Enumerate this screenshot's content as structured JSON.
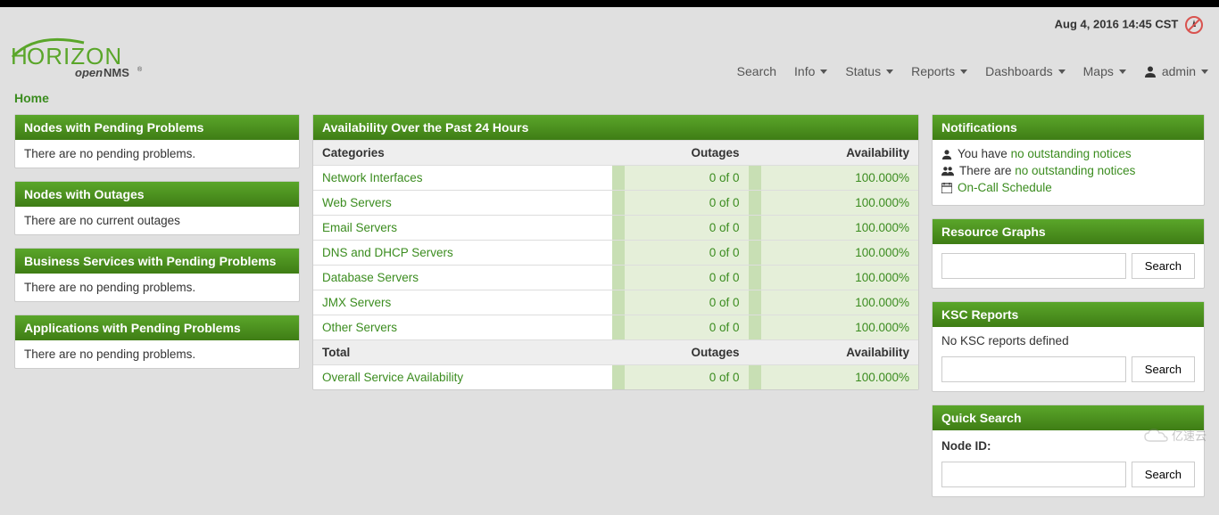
{
  "header": {
    "datetime": "Aug 4, 2016 14:45 CST",
    "logo_main": "HORIZON",
    "logo_sub": "openNMS"
  },
  "nav": {
    "search": "Search",
    "info": "Info",
    "status": "Status",
    "reports": "Reports",
    "dashboards": "Dashboards",
    "maps": "Maps",
    "admin": "admin"
  },
  "breadcrumb": {
    "home": "Home"
  },
  "left_panels": {
    "pending_nodes": {
      "title": "Nodes with Pending Problems",
      "body": "There are no pending problems."
    },
    "outages": {
      "title": "Nodes with Outages",
      "body": "There are no current outages"
    },
    "biz": {
      "title": "Business Services with Pending Problems",
      "body": "There are no pending problems."
    },
    "apps": {
      "title": "Applications with Pending Problems",
      "body": "There are no pending problems."
    }
  },
  "availability": {
    "title": "Availability Over the Past 24 Hours",
    "col_categories": "Categories",
    "col_outages": "Outages",
    "col_availability": "Availability",
    "rows": [
      {
        "name": "Network Interfaces",
        "outages": "0 of 0",
        "avail": "100.000%"
      },
      {
        "name": "Web Servers",
        "outages": "0 of 0",
        "avail": "100.000%"
      },
      {
        "name": "Email Servers",
        "outages": "0 of 0",
        "avail": "100.000%"
      },
      {
        "name": "DNS and DHCP Servers",
        "outages": "0 of 0",
        "avail": "100.000%"
      },
      {
        "name": "Database Servers",
        "outages": "0 of 0",
        "avail": "100.000%"
      },
      {
        "name": "JMX Servers",
        "outages": "0 of 0",
        "avail": "100.000%"
      },
      {
        "name": "Other Servers",
        "outages": "0 of 0",
        "avail": "100.000%"
      }
    ],
    "total_label": "Total",
    "total_outages": "Outages",
    "total_avail": "Availability",
    "overall": {
      "name": "Overall Service Availability",
      "outages": "0 of 0",
      "avail": "100.000%"
    }
  },
  "notifications": {
    "title": "Notifications",
    "you_prefix": "You have ",
    "you_link": "no outstanding notices",
    "there_prefix": "There are ",
    "there_link": "no outstanding notices",
    "oncall": "On-Call Schedule"
  },
  "resource_graphs": {
    "title": "Resource Graphs",
    "search_btn": "Search"
  },
  "ksc": {
    "title": "KSC Reports",
    "body": "No KSC reports defined",
    "search_btn": "Search"
  },
  "quick_search": {
    "title": "Quick Search",
    "node_id_label": "Node ID:",
    "search_btn": "Search"
  },
  "watermark": "亿速云"
}
